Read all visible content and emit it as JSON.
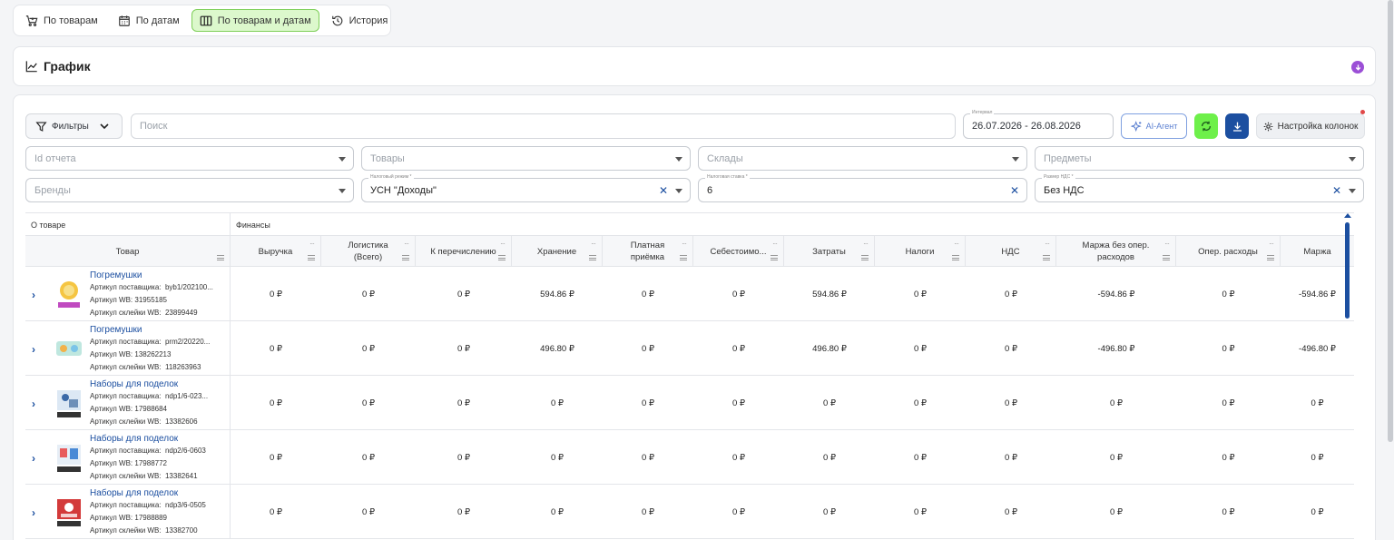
{
  "tabs": [
    {
      "label": "По товарам",
      "icon": "cart-icon"
    },
    {
      "label": "По датам",
      "icon": "calendar-icon"
    },
    {
      "label": "По товарам и датам",
      "icon": "columns-icon",
      "active": true
    },
    {
      "label": "История",
      "icon": "history-icon"
    }
  ],
  "chart_panel": {
    "title": "График"
  },
  "toolbar": {
    "filters_label": "Фильтры",
    "search_placeholder": "Поиск",
    "interval_label": "Интервал",
    "interval_value": "26.07.2026 - 26.08.2026",
    "ai_label": "AI-Агент",
    "columns_label": "Настройка колонок"
  },
  "filters": {
    "report_id": {
      "placeholder": "Id отчета"
    },
    "products": {
      "placeholder": "Товары"
    },
    "warehouses": {
      "placeholder": "Склады"
    },
    "subjects": {
      "placeholder": "Предметы"
    },
    "brands": {
      "placeholder": "Бренды"
    },
    "tax_regime": {
      "label": "Налоговый режим *",
      "value": "УСН \"Доходы\""
    },
    "tax_rate": {
      "label": "Налоговая ставка *",
      "value": "6"
    },
    "vat": {
      "label": "Размер НДС *",
      "value": "Без НДС"
    }
  },
  "table": {
    "group_headers": [
      "О товаре",
      "Финансы"
    ],
    "product_header": "Товар",
    "columns": [
      "Выручка",
      "Логистика (Всего)",
      "К перечислению",
      "Хранение",
      "Платная приёмка",
      "Себестоимо...",
      "Затраты",
      "Налоги",
      "НДС",
      "Маржа без опер. расходов",
      "Опер. расходы",
      "Маржа"
    ],
    "rows": [
      {
        "name": "Погремушки",
        "supplier_label": "Артикул поставщика:",
        "supplier": "byb1/202100...",
        "wb_label": "Артикул WB:",
        "wb": "31955185",
        "glue_label": "Артикул склейки WB:",
        "glue": "23899449",
        "values": [
          "0 ₽",
          "0 ₽",
          "0 ₽",
          "594.86 ₽",
          "0 ₽",
          "0 ₽",
          "594.86 ₽",
          "0 ₽",
          "0 ₽",
          "-594.86 ₽",
          "0 ₽",
          "-594.86 ₽"
        ]
      },
      {
        "name": "Погремушки",
        "supplier_label": "Артикул поставщика:",
        "supplier": "prm2/20220...",
        "wb_label": "Артикул WB:",
        "wb": "138262213",
        "glue_label": "Артикул склейки WB:",
        "glue": "118263963",
        "values": [
          "0 ₽",
          "0 ₽",
          "0 ₽",
          "496.80 ₽",
          "0 ₽",
          "0 ₽",
          "496.80 ₽",
          "0 ₽",
          "0 ₽",
          "-496.80 ₽",
          "0 ₽",
          "-496.80 ₽"
        ]
      },
      {
        "name": "Наборы для поделок",
        "supplier_label": "Артикул поставщика:",
        "supplier": "ndp1/6-023...",
        "wb_label": "Артикул WB:",
        "wb": "17988684",
        "glue_label": "Артикул склейки WB:",
        "glue": "13382606",
        "values": [
          "0 ₽",
          "0 ₽",
          "0 ₽",
          "0 ₽",
          "0 ₽",
          "0 ₽",
          "0 ₽",
          "0 ₽",
          "0 ₽",
          "0 ₽",
          "0 ₽",
          "0 ₽"
        ]
      },
      {
        "name": "Наборы для поделок",
        "supplier_label": "Артикул поставщика:",
        "supplier": "ndp2/6-0603",
        "wb_label": "Артикул WB:",
        "wb": "17988772",
        "glue_label": "Артикул склейки WB:",
        "glue": "13382641",
        "values": [
          "0 ₽",
          "0 ₽",
          "0 ₽",
          "0 ₽",
          "0 ₽",
          "0 ₽",
          "0 ₽",
          "0 ₽",
          "0 ₽",
          "0 ₽",
          "0 ₽",
          "0 ₽"
        ]
      },
      {
        "name": "Наборы для поделок",
        "supplier_label": "Артикул поставщика:",
        "supplier": "ndp3/6-0505",
        "wb_label": "Артикул WB:",
        "wb": "17988889",
        "glue_label": "Артикул склейки WB:",
        "glue": "13382700",
        "values": [
          "0 ₽",
          "0 ₽",
          "0 ₽",
          "0 ₽",
          "0 ₽",
          "0 ₽",
          "0 ₽",
          "0 ₽",
          "0 ₽",
          "0 ₽",
          "0 ₽",
          "0 ₽"
        ]
      }
    ]
  },
  "colors": {
    "accent": "#1c4fa0",
    "active_tab_bg": "#dcf8cc",
    "refresh_bg": "#6ef04a",
    "chart_toggle": "#9b4fd6"
  }
}
